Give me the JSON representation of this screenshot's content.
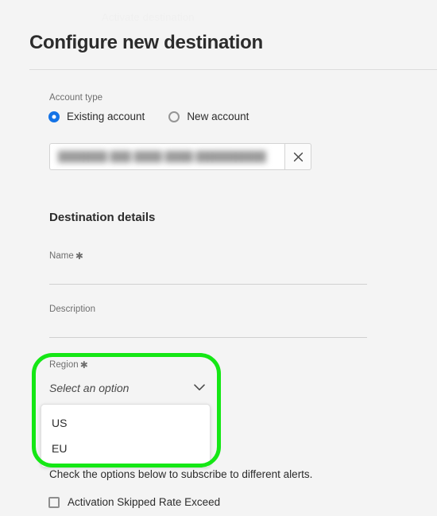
{
  "page": {
    "ghost_text": "Activate destination",
    "title": "Configure new destination"
  },
  "account_type": {
    "label": "Account type",
    "options": [
      {
        "label": "Existing account",
        "selected": true
      },
      {
        "label": "New account",
        "selected": false
      }
    ],
    "picker": {
      "value": "███████ ███ ████ ████ ██████████",
      "clear_label": "×"
    }
  },
  "destination_details": {
    "heading": "Destination details",
    "name": {
      "label": "Name",
      "required_marker": "✱",
      "value": "",
      "placeholder": ""
    },
    "description": {
      "label": "Description",
      "value": "",
      "placeholder": ""
    },
    "region": {
      "label": "Region",
      "required_marker": "✱",
      "selected_text": "Select an option",
      "options": [
        {
          "label": "US"
        },
        {
          "label": "EU"
        }
      ]
    }
  },
  "alerts": {
    "description": "Check the options below to subscribe to different alerts.",
    "items": [
      {
        "label": "Activation Skipped Rate Exceed",
        "checked": false
      }
    ]
  },
  "annotation": {
    "color": "#15e715",
    "target": "region-dropdown"
  }
}
